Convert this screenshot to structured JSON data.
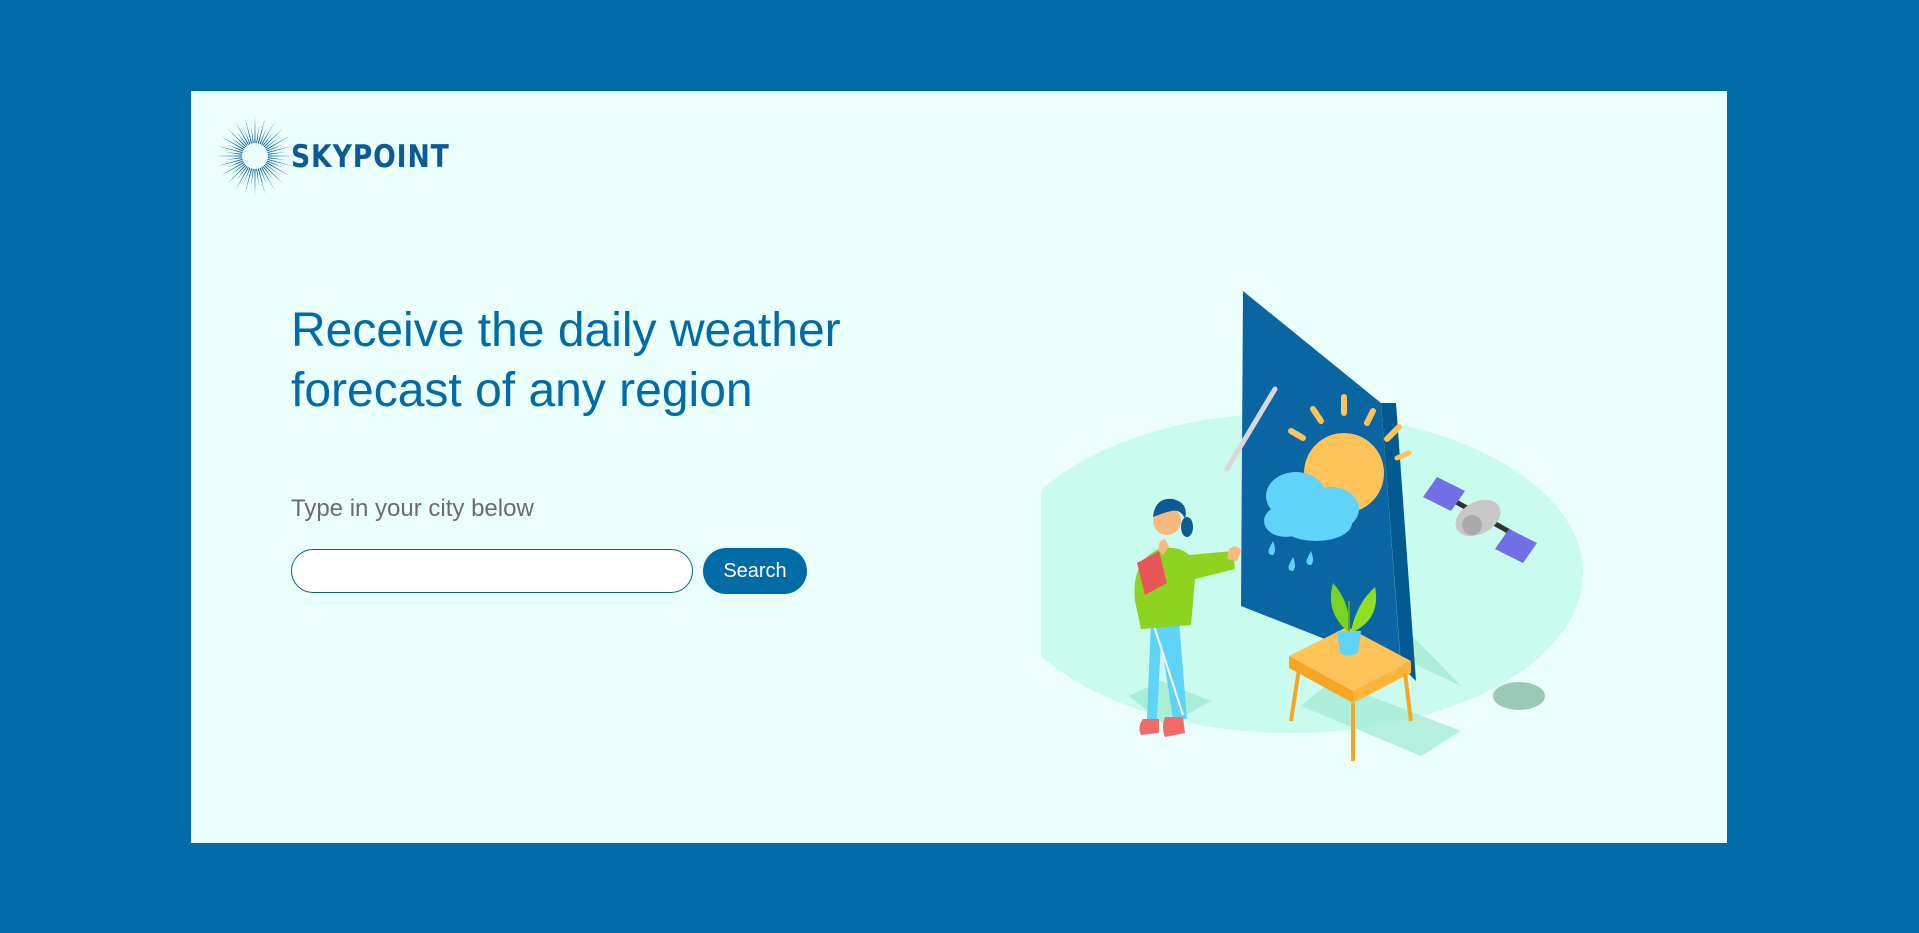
{
  "brand": {
    "name": "SKYPOINT",
    "color": "#0b5c96"
  },
  "hero": {
    "title": "Receive the daily weather forecast of any region"
  },
  "search": {
    "hint": "Type in your city below",
    "value": "",
    "placeholder": "",
    "button_label": "Search"
  },
  "colors": {
    "background": "#016ba7",
    "card": "#ebfffd",
    "accent": "#016ba7",
    "hint_text": "#6c6c6c"
  },
  "illustration": {
    "icon": "weather-presenter-illustration"
  }
}
